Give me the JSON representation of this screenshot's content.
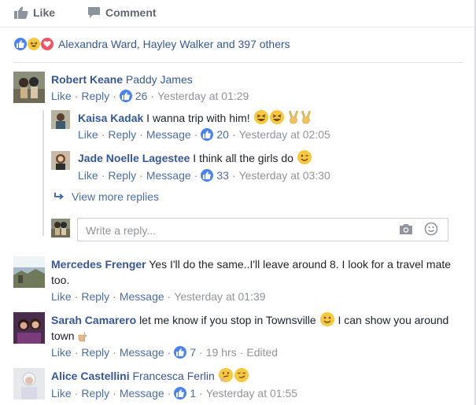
{
  "actions": {
    "like": "Like",
    "comment": "Comment"
  },
  "reactions_summary": "Alexandra Ward, Hayley Walker and 397 others",
  "placeholder": "Write a reply...",
  "view_more": "View more replies",
  "link_like": "Like",
  "link_reply": "Reply",
  "link_message": "Message",
  "dot": "·",
  "comments": [
    {
      "author": "Robert Keane",
      "text": "Paddy James",
      "likes": "26",
      "time": "Yesterday at 01:29"
    },
    {
      "author": "Kaisa Kadak",
      "text": "I wanna trip with him!",
      "likes": "20",
      "time": "Yesterday at 02:05"
    },
    {
      "author": "Jade Noelle Lagestee",
      "text": "I think all the girls do",
      "likes": "33",
      "time": "Yesterday at 03:30"
    },
    {
      "author": "Mercedes Frenger",
      "text": "Yes I'll do the same..I'll leave around 8. I look for a travel mate too.",
      "time": "Yesterday at 01:39"
    },
    {
      "author": "Sarah Camarero",
      "text": "let me know if you stop in Townsville",
      "text2": "I can show you around town",
      "likes": "7",
      "time": "19 hrs",
      "edited": "Edited"
    },
    {
      "author": "Alice Castellini",
      "text": "Francesca Ferlin",
      "likes": "1",
      "time": "Yesterday at 01:55"
    }
  ],
  "colors": {
    "link": "#365899",
    "meta": "#90949c",
    "like_blue": "#4a83f0"
  }
}
